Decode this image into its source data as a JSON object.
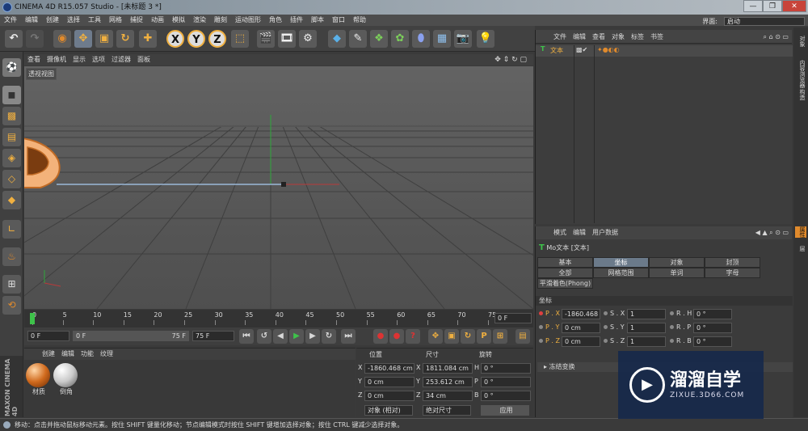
{
  "title": "CINEMA 4D R15.057 Studio - [未标题 3 *]",
  "menu": [
    "文件",
    "编辑",
    "创建",
    "选择",
    "工具",
    "网格",
    "捕捉",
    "动画",
    "模拟",
    "渲染",
    "雕刻",
    "运动图形",
    "角色",
    "插件",
    "脚本",
    "窗口",
    "帮助"
  ],
  "layout_label": "界面:",
  "layout_value": "启动",
  "win_buttons": [
    "—",
    "❐",
    "✕"
  ],
  "toolbar_icons": [
    "undo-icon",
    "redo-icon",
    "select-icon",
    "move-icon",
    "scale-icon",
    "rotate-icon",
    "add-icon",
    "x-axis-icon",
    "y-axis-icon",
    "z-axis-icon",
    "coordinate-system-icon",
    "render-view-icon",
    "render-picture-queue-icon",
    "render-settings-icon",
    "cube-icon",
    "pen-spline-icon",
    "subdivision-icon",
    "array-icon",
    "deformer-icon",
    "floor-icon",
    "camera-icon",
    "light-icon"
  ],
  "axis_letters": [
    "X",
    "Y",
    "Z"
  ],
  "viewport_menu": [
    "查看",
    "摄像机",
    "显示",
    "选项",
    "过滤器",
    "面板"
  ],
  "viewport_label": "透视视图",
  "timeline_ticks": [
    "0",
    "5",
    "10",
    "15",
    "20",
    "25",
    "30",
    "35",
    "40",
    "45",
    "50",
    "55",
    "60",
    "65",
    "70",
    "75"
  ],
  "timeline_end": "0 F",
  "transport": {
    "start": "0 F",
    "min": "0 F",
    "max": "75 F",
    "end": "75 F"
  },
  "material_menu": [
    "创建",
    "编辑",
    "功能",
    "纹理"
  ],
  "materials": [
    {
      "name": "材质",
      "color": "#d06a1d"
    },
    {
      "name": "倒角",
      "color": "#c9c9c9"
    }
  ],
  "coord_headers": [
    "位置",
    "尺寸",
    "旋转"
  ],
  "coord_rows": [
    {
      "axis": "X",
      "pos": "-1860.468 cm",
      "size_axis": "X",
      "size": "1811.084 cm",
      "rot_axis": "H",
      "rot": "0 °"
    },
    {
      "axis": "Y",
      "pos": "0 cm",
      "size_axis": "Y",
      "size": "253.612 cm",
      "rot_axis": "P",
      "rot": "0 °"
    },
    {
      "axis": "Z",
      "pos": "0 cm",
      "size_axis": "Z",
      "size": "34 cm",
      "rot_axis": "B",
      "rot": "0 °"
    }
  ],
  "coord_mode": "对象 (相对)",
  "coord_size_mode": "绝对尺寸",
  "apply_label": "应用",
  "objmgr_menu": [
    "文件",
    "编辑",
    "查看",
    "对象",
    "标签",
    "书签"
  ],
  "object_name": "文本",
  "attr_menu": [
    "模式",
    "编辑",
    "用户数据"
  ],
  "attr_title": "Mo文本 [文本]",
  "attr_tabs_row1": [
    "基本",
    "坐标",
    "对象",
    "封顶"
  ],
  "attr_tabs_row2": [
    "全部",
    "网格范围",
    "单词",
    "字母"
  ],
  "attr_tab_phong": "平滑着色(Phong)",
  "attr_section": "坐标",
  "attr_rows": [
    {
      "p": "P . X",
      "pv": "-1860.468",
      "s": "S . X",
      "sv": "1",
      "r": "R . H",
      "rv": "0 °"
    },
    {
      "p": "P . Y",
      "pv": "0 cm",
      "s": "S . Y",
      "sv": "1",
      "r": "R . P",
      "rv": "0 °"
    },
    {
      "p": "P . Z",
      "pv": "0 cm",
      "s": "S . Z",
      "sv": "1",
      "r": "R . B",
      "rv": "0 °"
    }
  ],
  "freeze_label": "冻结变换",
  "side_tabs": [
    "对象",
    "内容浏览器",
    "构造",
    "属性",
    "层"
  ],
  "status": "移动：点击并拖动鼠标移动元素。按住 SHIFT 键量化移动；节点编辑模式时按住 SHIFT 键增加选择对象；按住 CTRL 键减少选择对象。",
  "maxon_brand": "MAXON",
  "maxon_product": "CINEMA 4D",
  "watermark_title": "溜溜自学",
  "watermark_url": "ZIXUE.3D66.COM",
  "accent": "#e08a2c"
}
